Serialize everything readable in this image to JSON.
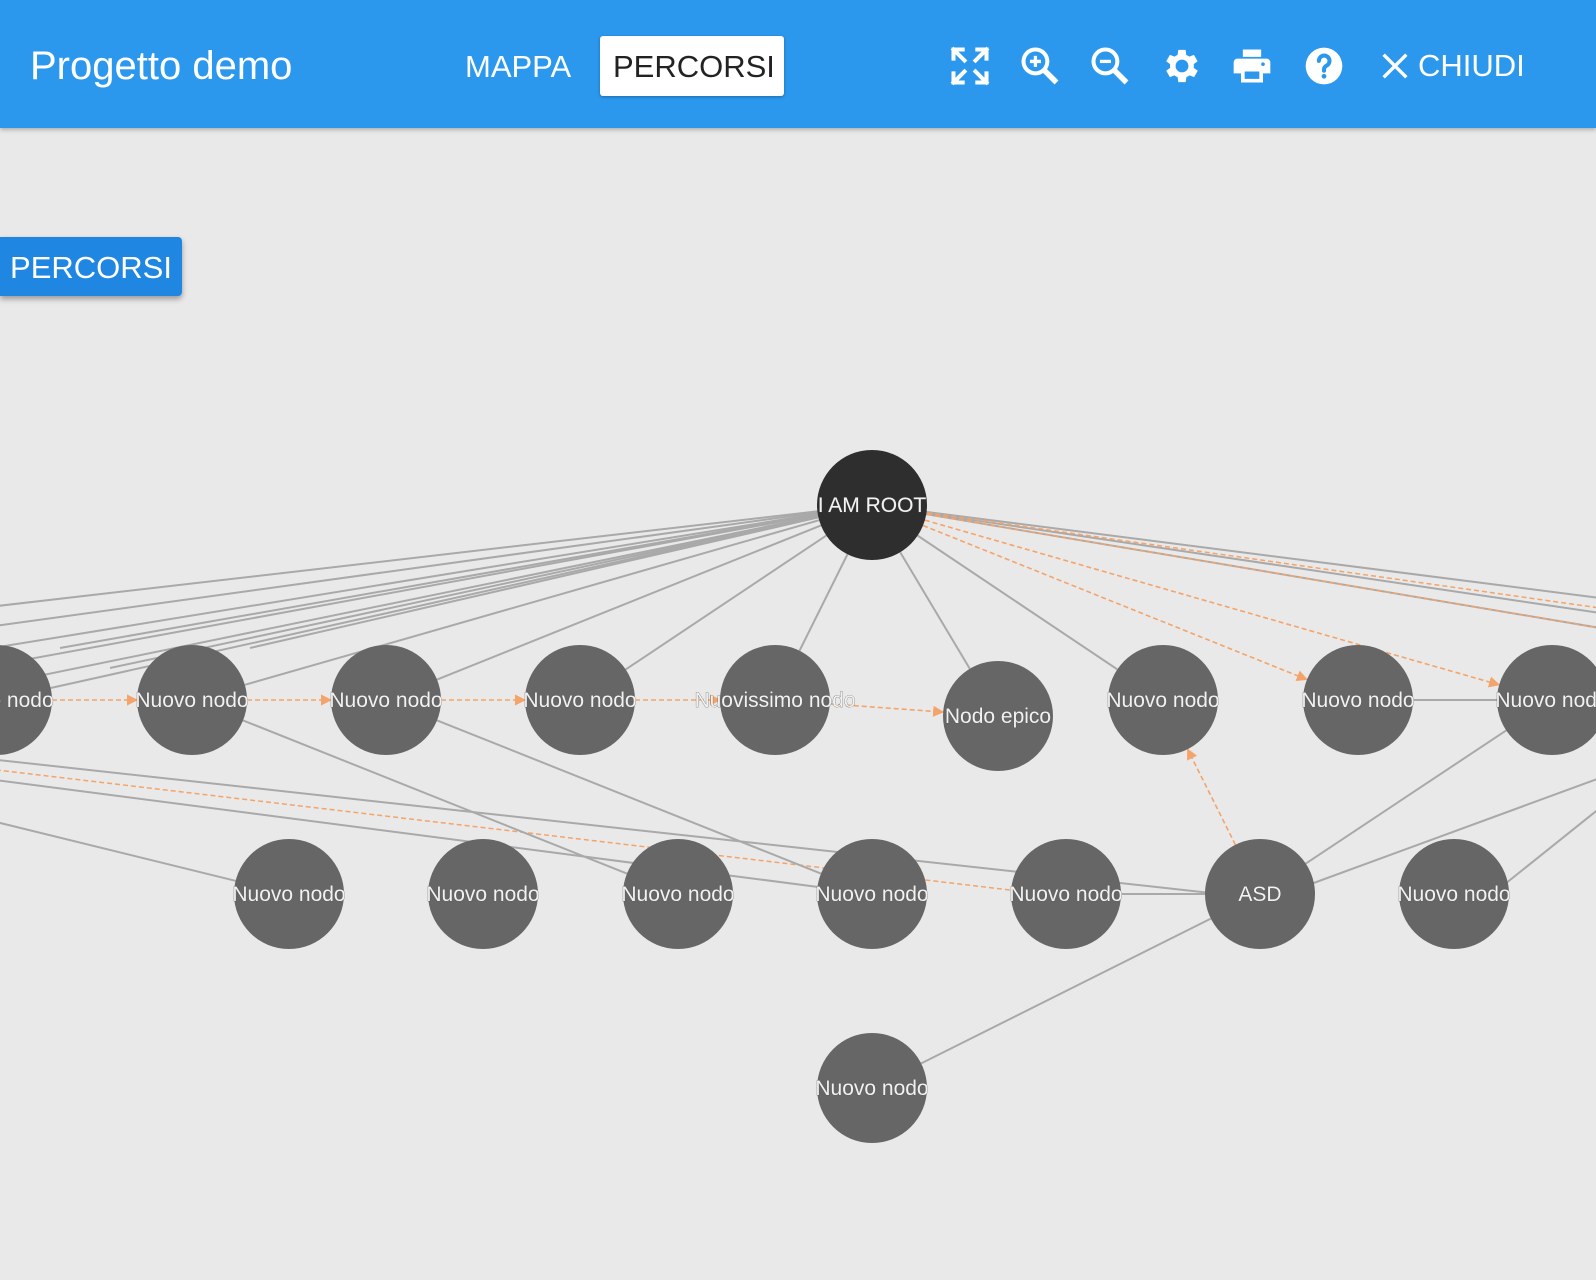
{
  "header": {
    "title": "Progetto demo",
    "tabs": [
      {
        "label": "MAPPA",
        "active": false
      },
      {
        "label": "PERCORSI",
        "active": true
      }
    ],
    "tools": [
      "fullscreen-icon",
      "zoom-in-icon",
      "zoom-out-icon",
      "gear-icon",
      "print-icon",
      "help-icon"
    ],
    "close_label": "CHIUDI"
  },
  "side_button_label": "PERCORSI",
  "colors": {
    "header": "#2b98ee",
    "root_node": "#2e2e2e",
    "node": "#666666",
    "edge": "#a9a9a9",
    "path_edge": "#f4a46a",
    "canvas": "#e9e9e9"
  },
  "graph": {
    "nodes": [
      {
        "id": "root",
        "label": "I AM ROOT",
        "root": true
      },
      {
        "id": "r1_0",
        "label": "Nuovo nodo"
      },
      {
        "id": "r1_1",
        "label": "Nuovo nodo"
      },
      {
        "id": "r1_2",
        "label": "Nuovo nodo"
      },
      {
        "id": "r1_3",
        "label": "Nuovo nodo"
      },
      {
        "id": "r1_4",
        "label": "Nuovissimo nodo"
      },
      {
        "id": "r1_5",
        "label": "Nodo epico"
      },
      {
        "id": "r1_6",
        "label": "Nuovo nodo"
      },
      {
        "id": "r1_7",
        "label": "Nuovo nodo"
      },
      {
        "id": "r1_8",
        "label": "Nuovo nodo"
      },
      {
        "id": "r2_0",
        "label": "Nuovo nodo"
      },
      {
        "id": "r2_1",
        "label": "Nuovo nodo"
      },
      {
        "id": "r2_2",
        "label": "Nuovo nodo"
      },
      {
        "id": "r2_3",
        "label": "Nuovo nodo"
      },
      {
        "id": "r2_4",
        "label": "Nuovo nodo"
      },
      {
        "id": "asd",
        "label": "ASD"
      },
      {
        "id": "r2_6",
        "label": "Nuovo nodo"
      },
      {
        "id": "r3_0",
        "label": "Nuovo nodo"
      }
    ],
    "edges": [
      {
        "from": "root",
        "to": "r1_0",
        "path": false
      },
      {
        "from": "root",
        "to": "r1_1",
        "path": false
      },
      {
        "from": "root",
        "to": "r1_2",
        "path": false
      },
      {
        "from": "root",
        "to": "r1_3",
        "path": false
      },
      {
        "from": "root",
        "to": "r1_4",
        "path": false
      },
      {
        "from": "root",
        "to": "r1_5",
        "path": false
      },
      {
        "from": "root",
        "to": "r1_6",
        "path": false
      },
      {
        "from": "root",
        "to": "r1_7",
        "path": true
      },
      {
        "from": "root",
        "to": "r1_8",
        "path": true
      },
      {
        "from": "r1_0",
        "to": "r1_1",
        "path": true
      },
      {
        "from": "r1_1",
        "to": "r1_2",
        "path": true
      },
      {
        "from": "r1_2",
        "to": "r1_3",
        "path": true
      },
      {
        "from": "r1_3",
        "to": "r1_4",
        "path": true
      },
      {
        "from": "r1_4",
        "to": "r1_5",
        "path": true
      },
      {
        "from": "r1_7",
        "to": "r1_8",
        "path": false
      },
      {
        "from": "r1_1",
        "to": "r2_2",
        "path": false
      },
      {
        "from": "r1_2",
        "to": "r2_3",
        "path": false
      },
      {
        "from": "asd",
        "to": "r1_6",
        "path": true
      },
      {
        "from": "asd",
        "to": "r1_8",
        "path": false
      },
      {
        "from": "asd",
        "to": "r3_0",
        "path": false
      },
      {
        "from": "r2_4",
        "to": "asd",
        "path": false
      }
    ]
  }
}
